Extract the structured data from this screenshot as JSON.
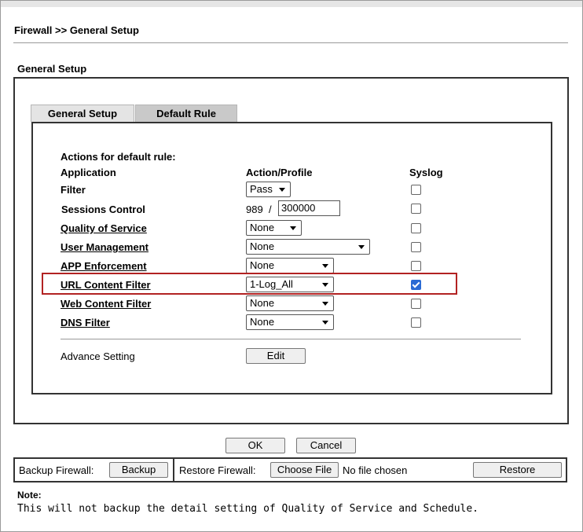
{
  "breadcrumb": "Firewall >> General Setup",
  "section_title": "General Setup",
  "tabs": [
    {
      "label": "General Setup",
      "active": false
    },
    {
      "label": "Default Rule",
      "active": true
    }
  ],
  "rules": {
    "heading": "Actions for default rule:",
    "col_application": "Application",
    "col_action": "Action/Profile",
    "col_syslog": "Syslog",
    "rows": [
      {
        "label": "Filter",
        "link": false,
        "action": "Pass",
        "syslog": false
      },
      {
        "label": "Sessions Control",
        "link": false,
        "current": "989",
        "slash": "/",
        "limit": "300000",
        "syslog": false
      },
      {
        "label": "Quality of Service",
        "link": true,
        "action": "None",
        "syslog": false
      },
      {
        "label": "User Management",
        "link": true,
        "action": "None",
        "syslog": false
      },
      {
        "label": "APP Enforcement",
        "link": true,
        "action": "None",
        "syslog": false
      },
      {
        "label": "URL Content Filter",
        "link": true,
        "action": "1-Log_All",
        "syslog": true,
        "highlighted": true
      },
      {
        "label": "Web Content Filter",
        "link": true,
        "action": "None",
        "syslog": false
      },
      {
        "label": "DNS Filter",
        "link": true,
        "action": "None",
        "syslog": false
      }
    ],
    "advance_label": "Advance Setting",
    "edit_button": "Edit"
  },
  "actions": {
    "ok": "OK",
    "cancel": "Cancel"
  },
  "backup": {
    "label": "Backup Firewall:",
    "button": "Backup"
  },
  "restore": {
    "label": "Restore Firewall:",
    "choose_file": "Choose File",
    "file_status": "No file chosen",
    "button": "Restore"
  },
  "note": {
    "title": "Note:",
    "text": "This will not backup the detail setting of Quality of Service and Schedule."
  },
  "colors": {
    "highlight_border": "#b22222",
    "checkbox_checked": "#2a6ad4"
  }
}
